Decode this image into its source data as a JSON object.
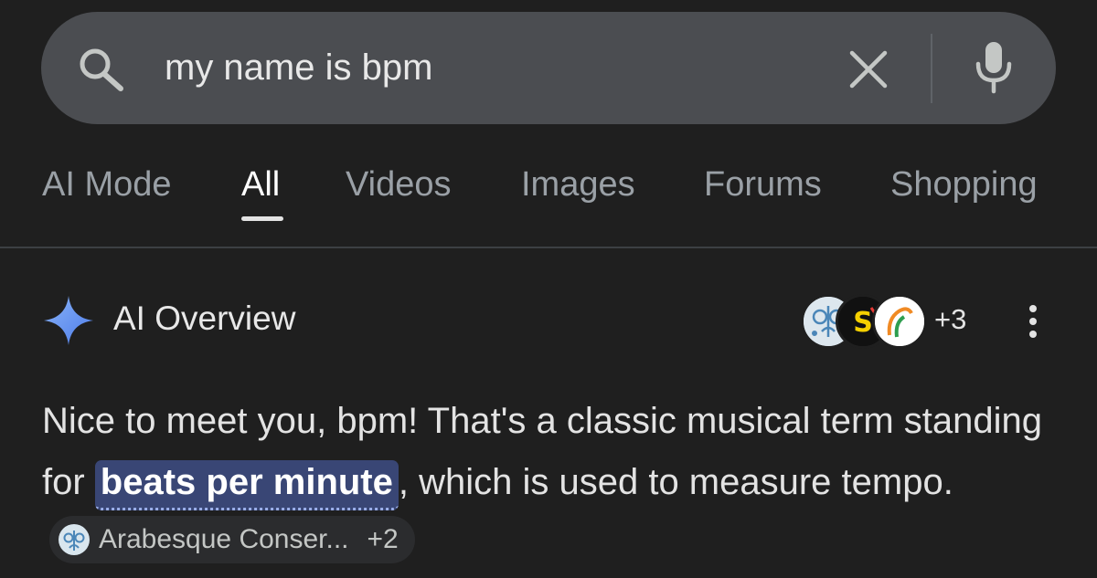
{
  "search": {
    "query": "my name is bpm"
  },
  "tabs": [
    {
      "label": "AI Mode",
      "active": false
    },
    {
      "label": "All",
      "active": true
    },
    {
      "label": "Videos",
      "active": false
    },
    {
      "label": "Images",
      "active": false
    },
    {
      "label": "Forums",
      "active": false
    },
    {
      "label": "Shopping",
      "active": false
    }
  ],
  "ai_overview": {
    "title": "AI Overview",
    "source_count": "+3",
    "text_before": "Nice to meet you, bpm! That's a classic musical term standing for ",
    "highlight": "beats per minute",
    "text_after": ", which is used to measure tempo.",
    "chip": {
      "label": "Arabesque Conser...",
      "count": "+2"
    }
  },
  "colors": {
    "background": "#1f1f1f",
    "search_bar": "#4b4d51",
    "highlight": "#394675",
    "sparkle": "#5b8def"
  },
  "icons": [
    "search-icon",
    "clear-icon",
    "mic-icon",
    "sparkle-icon",
    "more-vert-icon"
  ]
}
